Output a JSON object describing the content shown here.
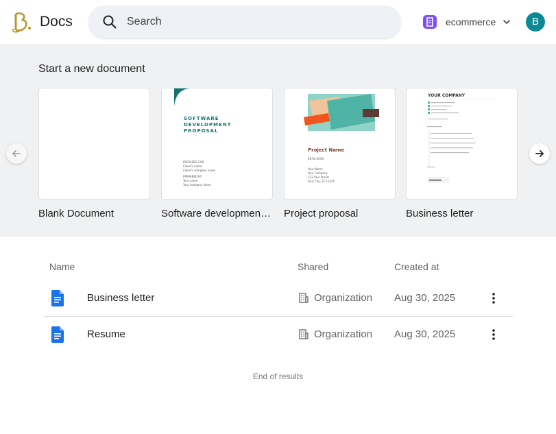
{
  "header": {
    "app_title": "Docs",
    "search_placeholder": "Search",
    "workspace_name": "ecommerce",
    "avatar_initial": "B",
    "colors": {
      "avatar": "#0b8a96",
      "workspace_icon": "#7c4dff",
      "logo_gold": "#b8962e"
    }
  },
  "templates": {
    "title": "Start a new document",
    "items": [
      {
        "label": "Blank Document"
      },
      {
        "label": "Software development proposal",
        "thumb": {
          "heading": "SOFTWARE\nDEVELOPMENT\nPROPOSAL",
          "prepared_for": "PREPARED FOR",
          "client_name": "Client's name",
          "client_company": "Client's company name",
          "prepared_by": "PREPARED BY",
          "your_name": "Your name",
          "your_company": "Your company name"
        }
      },
      {
        "label": "Project proposal",
        "thumb": {
          "heading": "Project Name",
          "date": "09.04.20XX",
          "lines": [
            "Your Name",
            "Your Company",
            "123 Your Street",
            "Your City, ST 12345"
          ]
        }
      },
      {
        "label": "Business letter",
        "thumb": {
          "heading": "YOUR COMPANY"
        }
      }
    ]
  },
  "documents": {
    "columns": {
      "name": "Name",
      "shared": "Shared",
      "created": "Created at"
    },
    "rows": [
      {
        "name": "Business letter",
        "shared": "Organization",
        "created": "Aug 30, 2025"
      },
      {
        "name": "Resume",
        "shared": "Organization",
        "created": "Aug 30, 2025"
      }
    ],
    "end_text": "End of results"
  },
  "icons": [
    "logo-icon",
    "search-icon",
    "workspace-icon",
    "chevron-down-icon",
    "arrow-left-icon",
    "arrow-right-icon",
    "doc-icon",
    "building-icon",
    "more-vert-icon"
  ]
}
